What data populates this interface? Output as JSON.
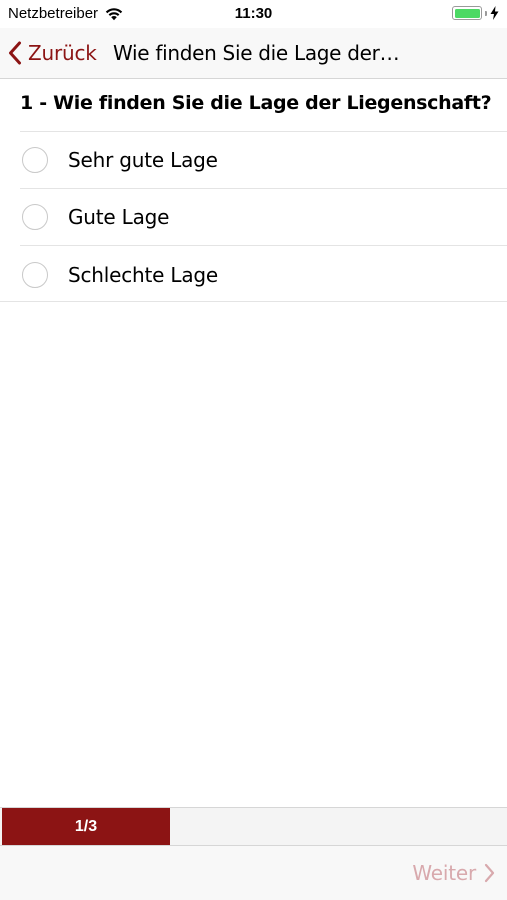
{
  "status_bar": {
    "carrier": "Netzbetreiber",
    "time": "11:30",
    "wifi_icon": "wifi-icon",
    "battery_icon": "battery-icon",
    "charging_icon": "bolt-icon",
    "battery_color": "#4cd964"
  },
  "nav_bar": {
    "back_label": "Zurück",
    "back_icon": "chevron-left-icon",
    "title": "Wie finden Sie die Lage der L...",
    "accent_color": "#8c1414"
  },
  "question": {
    "title": "1 - Wie finden Sie die Lage der Liegenschaft?",
    "options": [
      {
        "label": "Sehr gute Lage",
        "selected": false
      },
      {
        "label": "Gute Lage",
        "selected": false
      },
      {
        "label": "Schlechte Lage",
        "selected": false
      }
    ]
  },
  "progress": {
    "text": "1/3",
    "fraction": 0.3333,
    "fill_color": "#8c1414"
  },
  "toolbar": {
    "next_label": "Weiter",
    "next_icon": "chevron-right-icon",
    "next_color": "#d8a9ad"
  }
}
